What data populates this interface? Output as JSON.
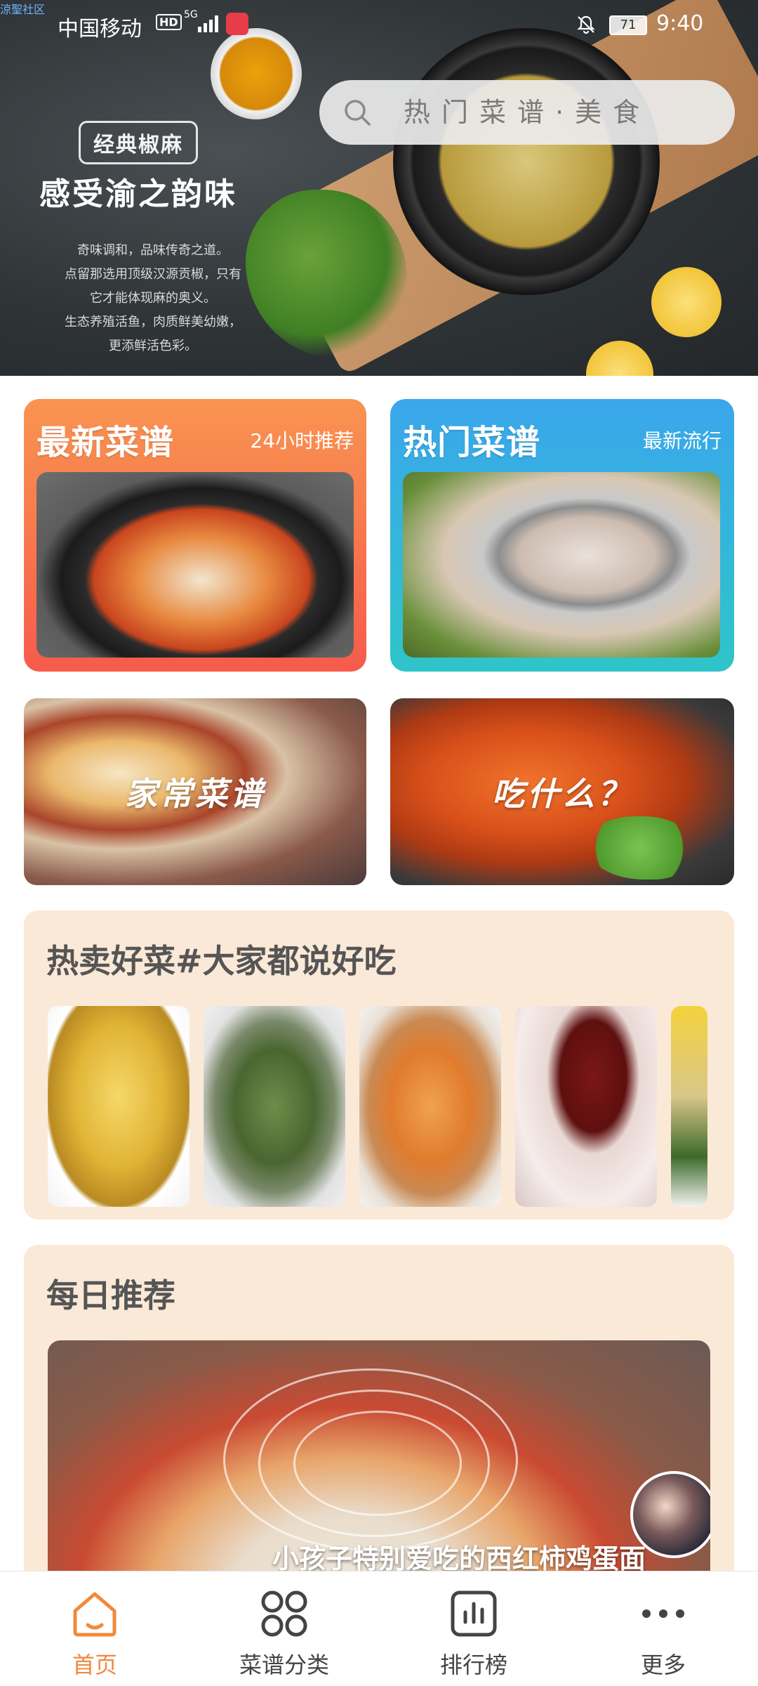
{
  "status_bar": {
    "corner_label": "涼聖社区",
    "carrier": "中国移动",
    "hd": "HD",
    "network": "5G",
    "battery": "71",
    "time": "9:40"
  },
  "search": {
    "placeholder": "热门菜谱·美食"
  },
  "hero": {
    "tag": "经典椒麻",
    "title": "感受渝之韵味",
    "description": [
      "奇味调和，品味传奇之道。",
      "点留那选用顶级汉源贡椒，只有",
      "它才能体现麻的奥义。",
      "生态养殖活鱼，肉质鲜美幼嫩，",
      "更添鲜活色彩。"
    ]
  },
  "cards": {
    "newest": {
      "title": "最新菜谱",
      "subtitle": "24小时推荐"
    },
    "popular": {
      "title": "热门菜谱",
      "subtitle": "最新流行"
    },
    "homestyle": {
      "label": "家常菜谱"
    },
    "what_to_eat": {
      "label": "吃什么？"
    }
  },
  "hot_dishes": {
    "title": "热卖好菜#大家都说好吃"
  },
  "daily": {
    "title": "每日推荐",
    "caption": "小孩子特别爱吃的西红柿鸡蛋面"
  },
  "bottom_nav": {
    "home": "首页",
    "categories": "菜谱分类",
    "ranking": "排行榜",
    "more": "更多"
  },
  "colors": {
    "accent": "#f08a3c",
    "card_newest_gradient": [
      "#f99450",
      "#f65b4c"
    ],
    "card_popular_gradient": [
      "#3aa6ec",
      "#2ec5c9"
    ],
    "panel_bg": "#fbe9d7"
  }
}
